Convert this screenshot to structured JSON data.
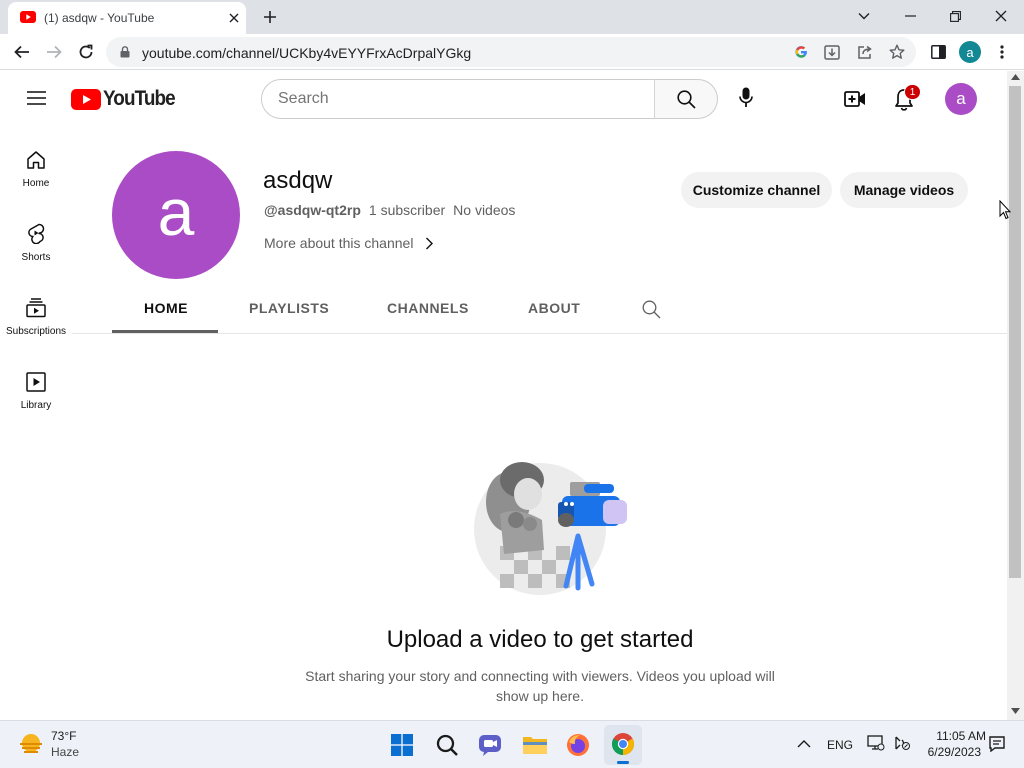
{
  "browser": {
    "tab_title": "(1) asdqw - YouTube",
    "url": "youtube.com/channel/UCKby4vEYYFrxAcDrpalYGkg",
    "profile_initial": "a"
  },
  "header": {
    "logo_text": "YouTube",
    "search_placeholder": "Search",
    "notification_count": "1",
    "avatar_initial": "a"
  },
  "guide": [
    {
      "label": "Home"
    },
    {
      "label": "Shorts"
    },
    {
      "label": "Subscriptions"
    },
    {
      "label": "Library"
    }
  ],
  "channel": {
    "avatar_initial": "a",
    "name": "asdqw",
    "handle": "@asdqw-qt2rp",
    "subscribers": "1 subscriber",
    "videos": "No videos",
    "more_about": "More about this channel",
    "customize_label": "Customize channel",
    "manage_label": "Manage videos",
    "tabs": [
      "HOME",
      "PLAYLISTS",
      "CHANNELS",
      "ABOUT"
    ]
  },
  "empty_state": {
    "title": "Upload a video to get started",
    "desc_line1": "Start sharing your story and connecting with viewers. Videos you upload will",
    "desc_line2": "show up here."
  },
  "taskbar": {
    "weather_temp": "73°F",
    "weather_desc": "Haze",
    "lang": "ENG",
    "time": "11:05 AM",
    "date": "6/29/2023"
  },
  "colors": {
    "avatar": "#a94cc5",
    "youtube_red": "#ff0000",
    "profile_teal": "#128894"
  }
}
